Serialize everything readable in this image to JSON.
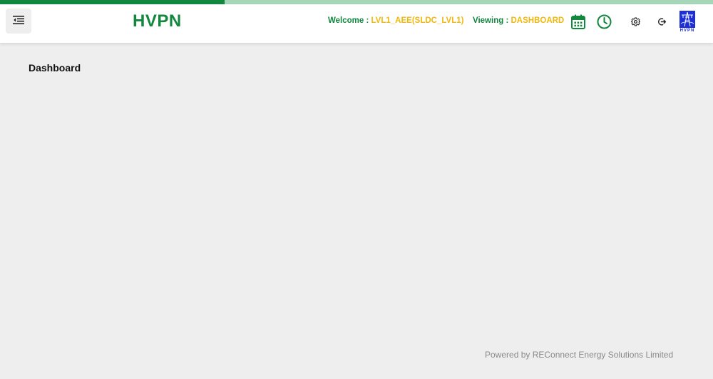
{
  "progress": {
    "fraction": 0.315,
    "fill_color": "#12873e",
    "track_color": "#a5d6b8"
  },
  "header": {
    "brand": "HVPN",
    "welcome_label": "Welcome :",
    "welcome_value": "LVL1_AEE(SLDC_LVL1)",
    "viewing_label": "Viewing :",
    "viewing_value": "DASHBOARD",
    "icons": [
      "menu-icon",
      "calendar-icon",
      "clock-icon",
      "gear-icon",
      "logout-icon",
      "hvpn-logo"
    ],
    "logo_text": "HVPN"
  },
  "colors": {
    "brand_green": "#12873e",
    "accent_yellow": "#f2b80c",
    "logo_blue": "#1d2fd6"
  },
  "main": {
    "page_title": "Dashboard"
  },
  "footer": {
    "text": "Powered by REConnect Energy Solutions Limited"
  }
}
